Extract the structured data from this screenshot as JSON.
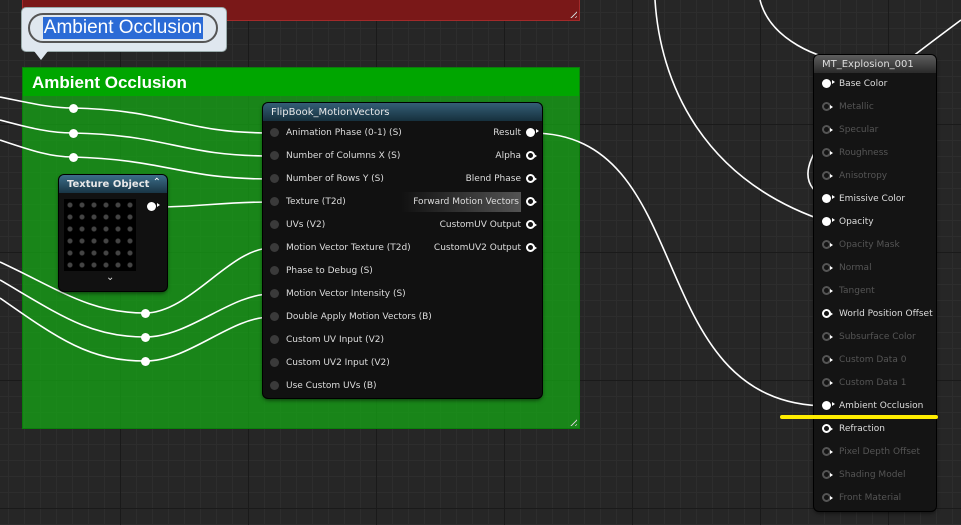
{
  "comment_bubble": {
    "text": "Ambient Occlusion"
  },
  "green_comment": {
    "title": "Ambient Occlusion"
  },
  "texture_node": {
    "title": "Texture Object",
    "collapse_glyph": "⌃",
    "expand_glyph": "⌄"
  },
  "flipbook_node": {
    "title": "FlipBook_MotionVectors",
    "inputs": [
      "Animation  Phase (0-1) (S)",
      "Number of Columns X (S)",
      "Number of Rows Y (S)",
      "Texture (T2d)",
      "UVs (V2)",
      "Motion Vector Texture (T2d)",
      "Phase to Debug (S)",
      "Motion Vector Intensity (S)",
      "Double Apply Motion Vectors (B)",
      "Custom UV Input (V2)",
      "Custom UV2 Input (V2)",
      "Use Custom UVs (B)"
    ],
    "outputs": [
      "Result",
      "Alpha",
      "Blend Phase",
      "Forward Motion Vectors",
      "CustomUV Output",
      "CustomUV2 Output"
    ]
  },
  "material_node": {
    "title": "MT_Explosion_001",
    "pins": [
      {
        "label": "Base Color",
        "active": true
      },
      {
        "label": "Metallic",
        "active": false
      },
      {
        "label": "Specular",
        "active": false
      },
      {
        "label": "Roughness",
        "active": false
      },
      {
        "label": "Anisotropy",
        "active": false
      },
      {
        "label": "Emissive Color",
        "active": true
      },
      {
        "label": "Opacity",
        "active": true
      },
      {
        "label": "Opacity Mask",
        "active": false
      },
      {
        "label": "Normal",
        "active": false
      },
      {
        "label": "Tangent",
        "active": false
      },
      {
        "label": "World Position Offset",
        "active": true
      },
      {
        "label": "Subsurface Color",
        "active": false
      },
      {
        "label": "Custom Data 0",
        "active": false
      },
      {
        "label": "Custom Data 1",
        "active": false
      },
      {
        "label": "Ambient Occlusion",
        "active": true
      },
      {
        "label": "Refraction",
        "active": true
      },
      {
        "label": "Pixel Depth Offset",
        "active": false
      },
      {
        "label": "Shading Model",
        "active": false
      },
      {
        "label": "Front Material",
        "active": false
      }
    ]
  },
  "colors": {
    "highlight_underline": "#ffee00",
    "comment_green": "#00a600",
    "comment_red": "#7a1818"
  }
}
